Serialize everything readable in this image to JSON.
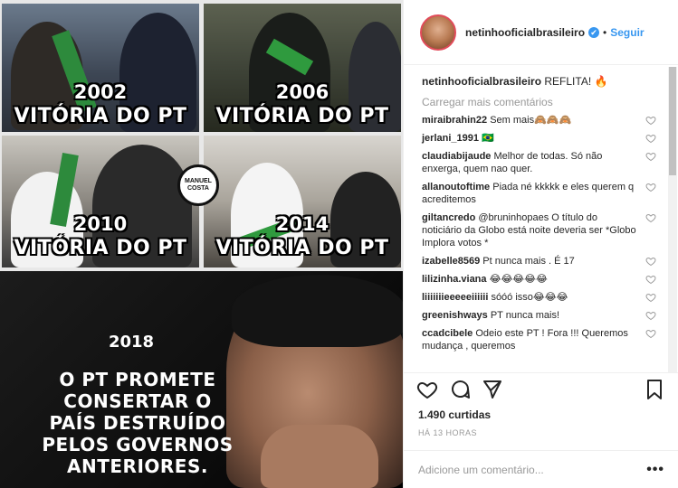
{
  "media": {
    "panels": [
      {
        "year": "2002",
        "label": "VITÓRIA DO PT"
      },
      {
        "year": "2006",
        "label": "VITÓRIA DO PT"
      },
      {
        "year": "2010",
        "label": "VITÓRIA DO PT"
      },
      {
        "year": "2014",
        "label": "VITÓRIA DO PT"
      }
    ],
    "stamp": "MANUEL COSTA",
    "bottom_year": "2018",
    "bottom_lines": [
      "O PT PROMETE",
      "CONSERTAR O",
      "PAÍS DESTRUÍDO",
      "PELOS GOVERNOS",
      "ANTERIORES."
    ]
  },
  "header": {
    "username": "netinhooficialbrasileiro",
    "verified": "✔",
    "separator": "•",
    "follow": "Seguir"
  },
  "caption": {
    "user": "netinhooficialbrasileiro",
    "text": "REFLITA! 🔥"
  },
  "load_more": "Carregar mais comentários",
  "comments": [
    {
      "user": "miraibrahin22",
      "text": "Sem mais🙈🙈🙈"
    },
    {
      "user": "jerlani_1991",
      "text": "🇧🇷"
    },
    {
      "user": "claudiabijaude",
      "text": "Melhor de todas. Só não enxerga, quem nao quer."
    },
    {
      "user": "allanoutoftime",
      "text": "Piada né kkkkk e eles querem q acreditemos"
    },
    {
      "user": "giltancredo",
      "text": "@bruninhopaes O título do noticiário da Globo está noite deveria ser *Globo Implora votos *"
    },
    {
      "user": "izabelle8569",
      "text": "Pt nunca mais . É 17"
    },
    {
      "user": "lilizinha.viana",
      "text": "😂😂😂😂😂"
    },
    {
      "user": "liiiiiiieeeeeiiiiii",
      "text": "sóóó isso😂😂😂"
    },
    {
      "user": "greenishways",
      "text": "PT nunca mais!"
    },
    {
      "user": "ccadcibele",
      "text": "Odeio este PT ! Fora !!! Queremos mudança , queremos"
    }
  ],
  "likes": "1.490 curtidas",
  "time": "HÁ 13 HORAS",
  "add_comment": {
    "placeholder": "Adicione um comentário...",
    "more": "•••"
  },
  "colors": {
    "accent": "#3897f0",
    "border": "#efefef",
    "muted": "#999999"
  }
}
